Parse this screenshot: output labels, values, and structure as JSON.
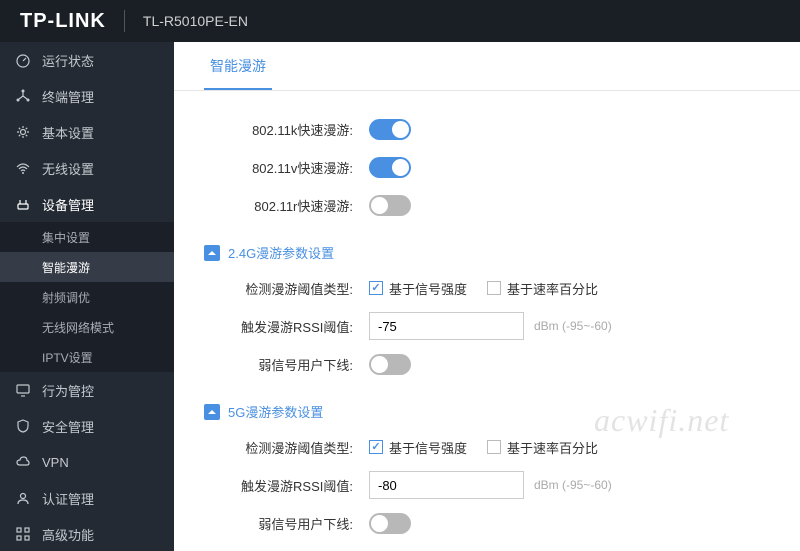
{
  "header": {
    "brand": "TP-LINK",
    "model": "TL-R5010PE-EN"
  },
  "sidebar": {
    "items": [
      {
        "label": "运行状态"
      },
      {
        "label": "终端管理"
      },
      {
        "label": "基本设置"
      },
      {
        "label": "无线设置"
      },
      {
        "label": "设备管理",
        "active": true,
        "children": [
          {
            "label": "集中设置"
          },
          {
            "label": "智能漫游",
            "selected": true
          },
          {
            "label": "射频调优"
          },
          {
            "label": "无线网络模式"
          },
          {
            "label": "IPTV设置"
          }
        ]
      },
      {
        "label": "行为管控"
      },
      {
        "label": "安全管理"
      },
      {
        "label": "VPN"
      },
      {
        "label": "认证管理"
      },
      {
        "label": "高级功能"
      }
    ]
  },
  "tab": {
    "label": "智能漫游"
  },
  "roaming": {
    "row_11k": {
      "label": "802.11k快速漫游:",
      "on": true
    },
    "row_11v": {
      "label": "802.11v快速漫游:",
      "on": true
    },
    "row_11r": {
      "label": "802.11r快速漫游:",
      "on": false
    }
  },
  "section24": {
    "title": "2.4G漫游参数设置",
    "threshold_label": "检测漫游阈值类型:",
    "chk_signal": "基于信号强度",
    "chk_rate": "基于速率百分比",
    "rssi_label": "触发漫游RSSI阈值:",
    "rssi_value": "-75",
    "rssi_unit": "dBm  (-95~-60)",
    "weak_label": "弱信号用户下线:",
    "weak_on": false
  },
  "section5": {
    "title": "5G漫游参数设置",
    "threshold_label": "检测漫游阈值类型:",
    "chk_signal": "基于信号强度",
    "chk_rate": "基于速率百分比",
    "rssi_label": "触发漫游RSSI阈值:",
    "rssi_value": "-80",
    "rssi_unit": "dBm  (-95~-60)",
    "weak_label": "弱信号用户下线:",
    "weak_on": false
  },
  "watermark": "acwifi.net"
}
